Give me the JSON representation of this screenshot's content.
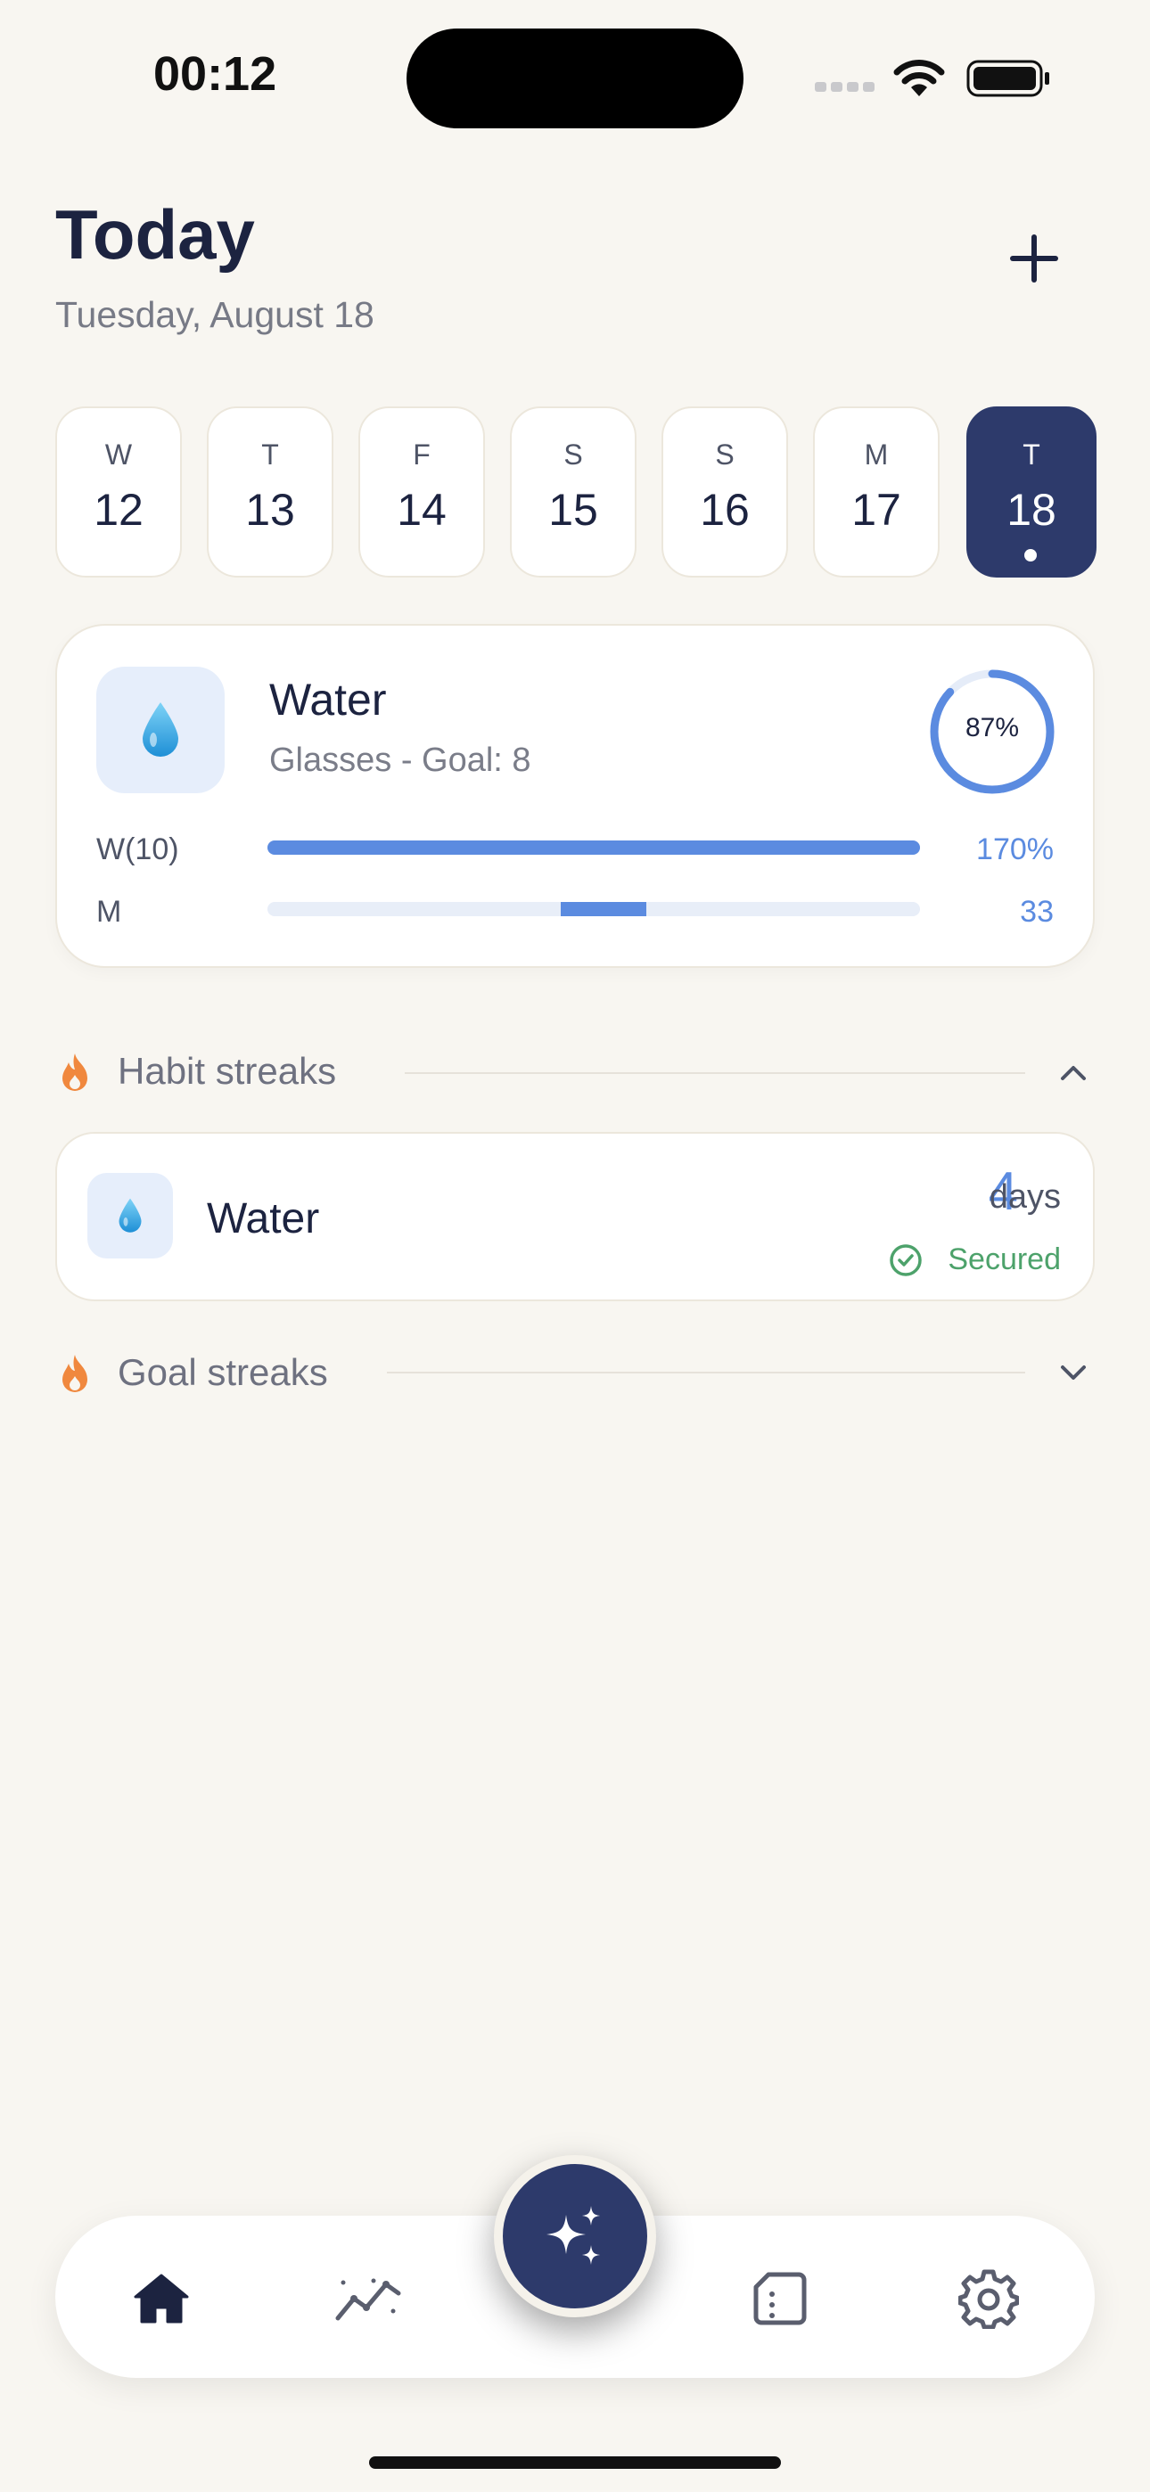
{
  "status_bar": {
    "time": "00:12"
  },
  "header": {
    "title": "Today",
    "date": "Tuesday, August 18"
  },
  "days": [
    {
      "letter": "W",
      "num": "12",
      "selected": false
    },
    {
      "letter": "T",
      "num": "13",
      "selected": false
    },
    {
      "letter": "F",
      "num": "14",
      "selected": false
    },
    {
      "letter": "S",
      "num": "15",
      "selected": false
    },
    {
      "letter": "S",
      "num": "16",
      "selected": false
    },
    {
      "letter": "M",
      "num": "17",
      "selected": false
    },
    {
      "letter": "T",
      "num": "18",
      "selected": true
    }
  ],
  "water_card": {
    "icon": "water-drop-icon",
    "title": "Water",
    "subtitle": "Glasses - Goal: 8",
    "progress_percent": 87,
    "progress_label": "87%",
    "rows": [
      {
        "label": "W(10)",
        "value": "170%",
        "fill_fraction": 1.0
      },
      {
        "label": "M",
        "value": "33",
        "marker_from": 0.45,
        "marker_to": 0.58
      }
    ]
  },
  "habit_streaks": {
    "title": "Habit streaks",
    "expanded": true,
    "items": [
      {
        "icon": "water-drop-icon",
        "name": "Water",
        "count": "4",
        "unit": "days",
        "status": "Secured"
      }
    ]
  },
  "goal_streaks": {
    "title": "Goal streaks",
    "expanded": false
  },
  "tab_bar": {
    "tabs": [
      "home-icon",
      "trend-chart-icon",
      "sparkles-icon",
      "document-icon",
      "gear-icon"
    ],
    "active": "home-icon"
  },
  "colors": {
    "accent": "#5B8BE0",
    "navy": "#2D3A6B",
    "background": "#F8F6F1",
    "flame": "#F0883E",
    "success": "#4DA26B"
  }
}
